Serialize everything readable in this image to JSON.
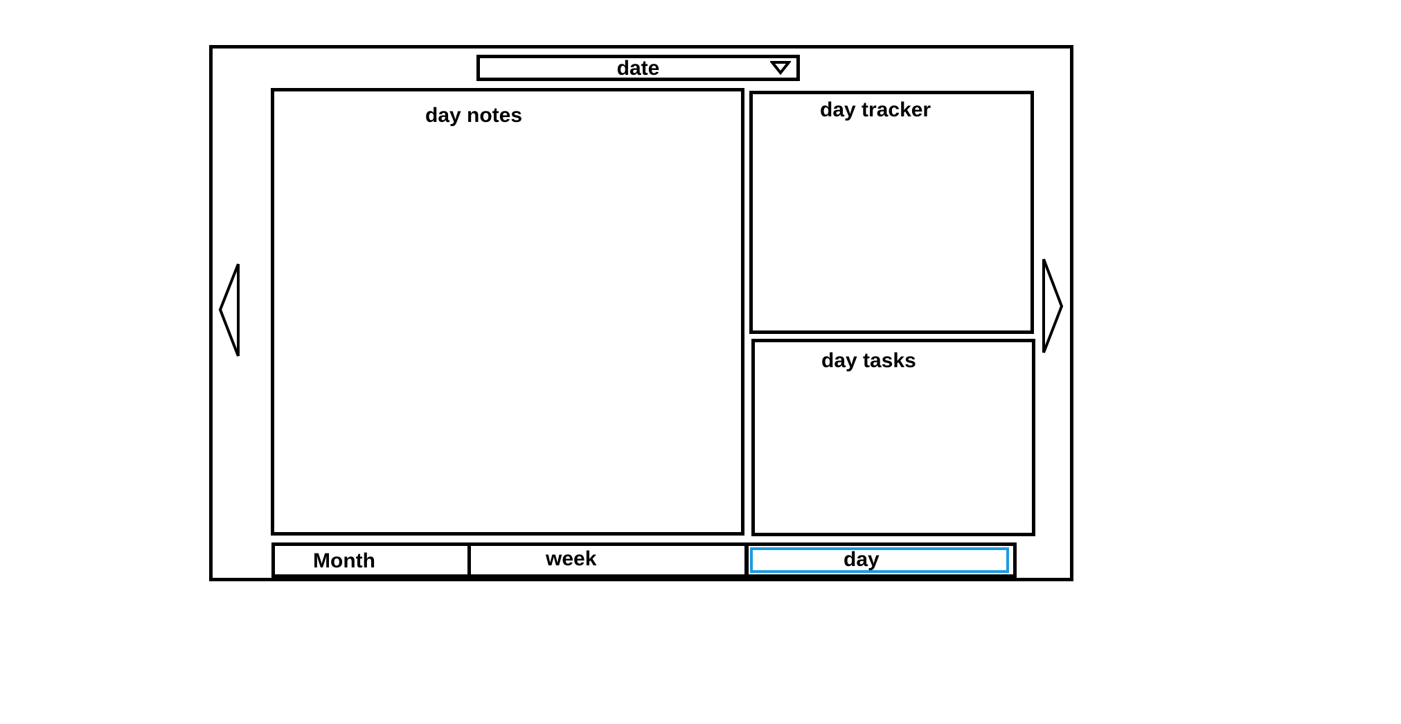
{
  "date_selector": {
    "label": "date",
    "icon": "caret-down-icon"
  },
  "panels": {
    "notes_title": "day notes",
    "tracker_title": "day tracker",
    "tasks_title": "day tasks"
  },
  "navigation": {
    "prev_icon": "chevron-left-icon",
    "next_icon": "chevron-right-icon"
  },
  "view_tabs": {
    "month_label": "Month",
    "week_label": "week",
    "day_label": "day",
    "selected": "day"
  },
  "colors": {
    "line": "#000000",
    "selected_tab_highlight": "#1e9be0",
    "background": "#ffffff"
  }
}
